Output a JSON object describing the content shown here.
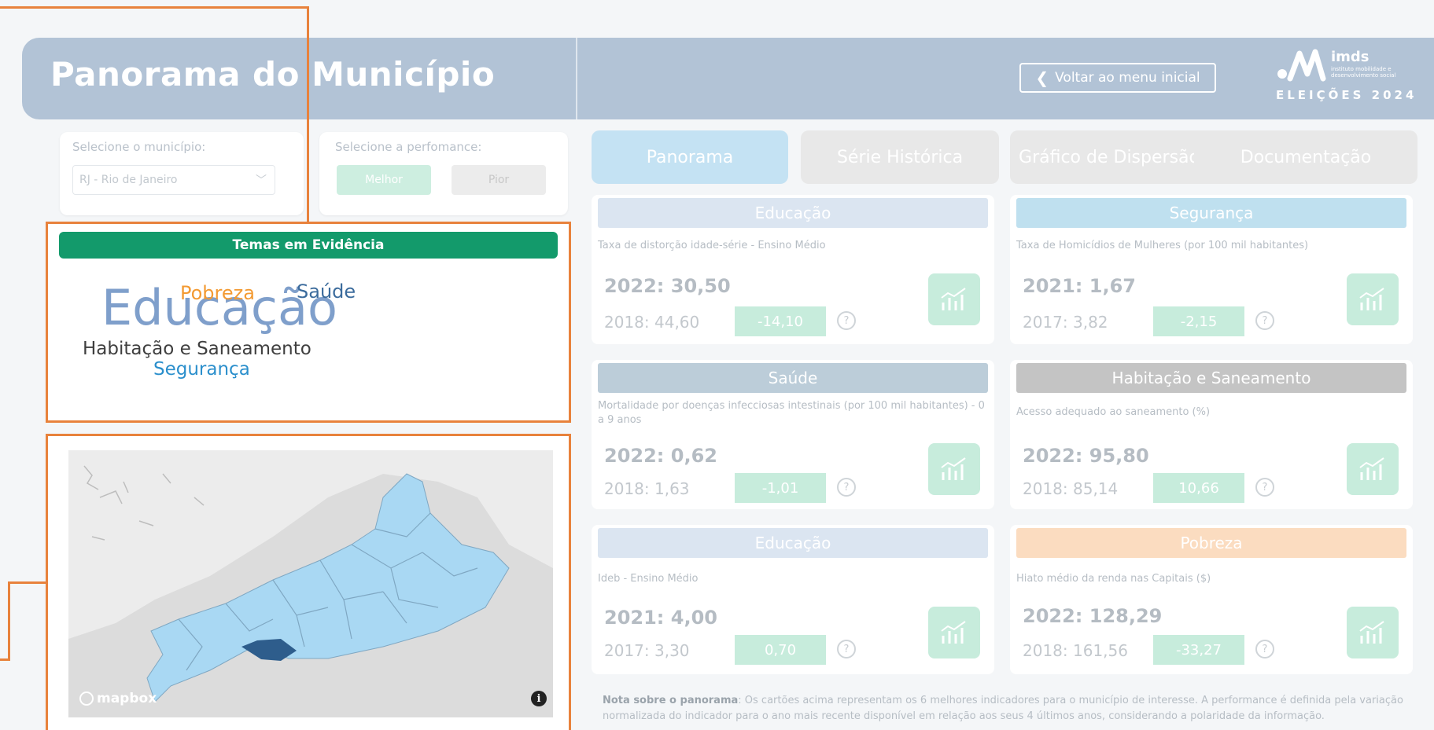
{
  "header": {
    "title": "Panorama do Município",
    "back_button": "Voltar ao menu inicial",
    "logo_name": "imds",
    "logo_sub": "instituto mobilidade e desenvolvimento social",
    "logo_event": "ELEIÇÕES 2024"
  },
  "selectors": {
    "municipio_label": "Selecione o município:",
    "municipio_value": "RJ - Rio de Janeiro",
    "performance_label": "Selecione a perfomance:",
    "performance_best": "Melhor",
    "performance_worst": "Pior"
  },
  "themes": {
    "title": "Temas em Evidência",
    "words": [
      {
        "text": "Educação",
        "color": "#7f9fcb"
      },
      {
        "text": "Pobreza",
        "color": "#f39a32"
      },
      {
        "text": "Saúde",
        "color": "#3b6b9c"
      },
      {
        "text": "Habitação e Saneamento",
        "color": "#3f3f3f"
      },
      {
        "text": "Segurança",
        "color": "#2b8fcc"
      }
    ]
  },
  "map": {
    "attribution": "mapbox",
    "info_symbol": "i",
    "highlight_color": "#2e5d8c",
    "region_color": "#a9d8f3"
  },
  "tabs": [
    {
      "label": "Panorama",
      "active": true
    },
    {
      "label": "Série Histórica",
      "active": false
    },
    {
      "label": "Gráfico de Dispersão",
      "active": false
    },
    {
      "label": "Documentação",
      "active": false
    }
  ],
  "cards": [
    {
      "theme": "Educação",
      "color": "#dbe5f1",
      "desc": "Taxa de distorção idade-série - Ensino Médio",
      "current": "2022: 30,50",
      "previous": "2018: 44,60",
      "diff": "-14,10"
    },
    {
      "theme": "Segurança",
      "color": "#bfe0ef",
      "desc": "Taxa de Homicídios de Mulheres (por 100 mil habitantes)",
      "current": "2021: 1,67",
      "previous": "2017: 3,82",
      "diff": "-2,15"
    },
    {
      "theme": "Saúde",
      "color": "#bccdd9",
      "desc": "Mortalidade por doenças infecciosas intestinais (por 100 mil habitantes) - 0 a 9 anos",
      "current": "2022: 0,62",
      "previous": "2018: 1,63",
      "diff": "-1,01"
    },
    {
      "theme": "Habitação e Saneamento",
      "color": "#c4c4c4",
      "desc": "Acesso adequado ao saneamento (%)",
      "current": "2022: 95,80",
      "previous": "2018: 85,14",
      "diff": "10,66"
    },
    {
      "theme": "Educação",
      "color": "#dbe5f1",
      "desc": "Ideb - Ensino Médio",
      "current": "2021: 4,00",
      "previous": "2017: 3,30",
      "diff": "0,70"
    },
    {
      "theme": "Pobreza",
      "color": "#fbdcc0",
      "desc": "Hiato médio da renda nas Capitais ($)",
      "current": "2022: 128,29",
      "previous": "2018: 161,56",
      "diff": "-33,27"
    }
  ],
  "help_symbol": "?",
  "note": {
    "label": "Nota sobre o panorama",
    "text": ": Os cartões acima representam os 6 melhores indicadores para o município de interesse. A performance é definida pela variação normalizada do indicador para o ano mais recente disponível em relação aos seus 4 últimos anos, considerando a polaridade da informação."
  }
}
